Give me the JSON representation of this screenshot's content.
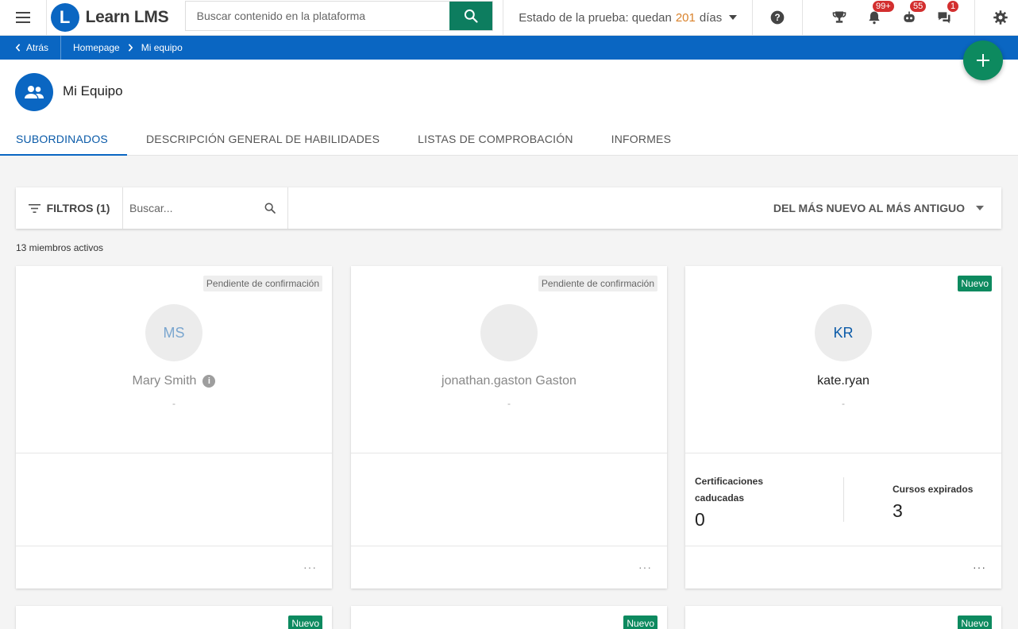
{
  "header": {
    "logo_letter": "L",
    "logo_text": "Learn LMS",
    "search_placeholder": "Buscar contenido en la plataforma",
    "trial_prefix": "Estado de la prueba: quedan",
    "trial_days": "201",
    "trial_suffix": "días",
    "badges": {
      "notifications": "99+",
      "bot": "55",
      "chat": "1"
    }
  },
  "breadcrumb": {
    "back": "Atrás",
    "items": [
      "Homepage",
      "Mi equipo"
    ]
  },
  "page": {
    "title": "Mi Equipo",
    "tabs": [
      "SUBORDINADOS",
      "DESCRIPCIÓN GENERAL DE HABILIDADES",
      "LISTAS DE COMPROBACIÓN",
      "INFORMES"
    ],
    "active_tab": 0
  },
  "filters": {
    "label": "FILTROS (1)",
    "search_placeholder": "Buscar...",
    "sort_label": "DEL MÁS NUEVO AL MÁS ANTIGUO"
  },
  "member_count": "13 miembros activos",
  "cards": [
    {
      "tag": "Pendiente de confirmación",
      "initials": "MS",
      "name": "Mary Smith",
      "subtitle": "-"
    },
    {
      "tag": "Pendiente de confirmación",
      "initials": "",
      "name": "jonathan.gaston Gaston",
      "subtitle": "-"
    },
    {
      "tag": "Nuevo",
      "initials": "KR",
      "name": "kate.ryan",
      "subtitle": "-",
      "stats": {
        "cert_label_1": "Certificaciones",
        "cert_label_2": "caducadas",
        "cert_value": "0",
        "courses_label": "Cursos expirados",
        "courses_value": "3"
      }
    }
  ],
  "peek_tags": [
    "Nuevo",
    "Nuevo",
    "Nuevo"
  ],
  "more_glyph": "···",
  "colors": {
    "primary": "#0a66c2",
    "green": "#0d8a5f",
    "accent_days": "#d9822b",
    "badge": "#d32f2f"
  }
}
